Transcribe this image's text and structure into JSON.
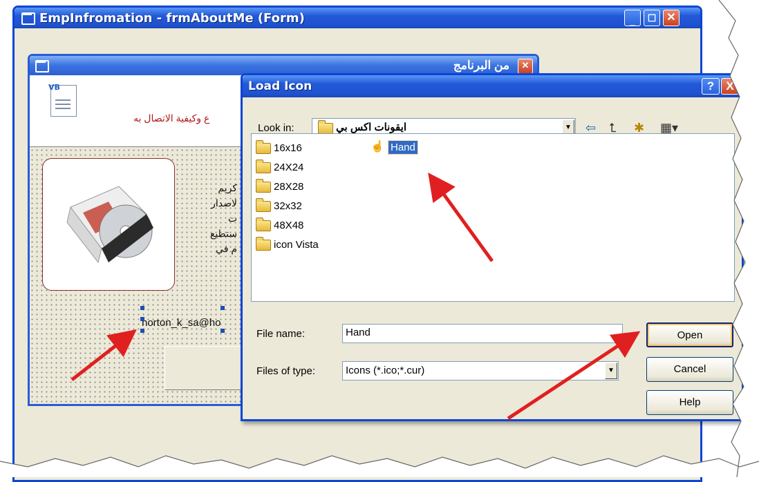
{
  "outer_window": {
    "title": "EmpInfromation - frmAboutMe (Form)"
  },
  "inner_form": {
    "title": "من البرنامج",
    "header_text": "ع وكيفية الاتصال به",
    "body_lines": [
      "كريم",
      "لاصدار",
      "ت",
      "ستطيع",
      "م في"
    ],
    "email_label": "norton_k_sa@ho"
  },
  "dialog": {
    "title": "Load Icon",
    "help_glyph": "?",
    "close_glyph": "X",
    "look_in_label": "Look in:",
    "look_in_value": "ايقونات اكس بي",
    "folders": [
      "16x16",
      "24X24",
      "28X28",
      "32x32",
      "48X48",
      "icon Vista"
    ],
    "selected_file": "Hand",
    "file_name_label": "File name:",
    "file_name_value": "Hand",
    "files_of_type_label": "Files of type:",
    "files_of_type_value": "Icons (*.ico;*.cur)",
    "buttons": {
      "open": "Open",
      "cancel": "Cancel",
      "help": "Help"
    }
  },
  "icons": [
    "back-arrow-icon",
    "up-folder-icon",
    "new-folder-icon",
    "view-menu-icon",
    "hand-cursor-icon",
    "folder-icon",
    "vb-file-icon",
    "cd-case-image"
  ],
  "colors": {
    "xp_title_blue": "#2258d8",
    "xp_close_red": "#c94222",
    "selection_blue": "#316ac5",
    "arrow_red": "#e02020",
    "dialog_face": "#ece9d8"
  }
}
